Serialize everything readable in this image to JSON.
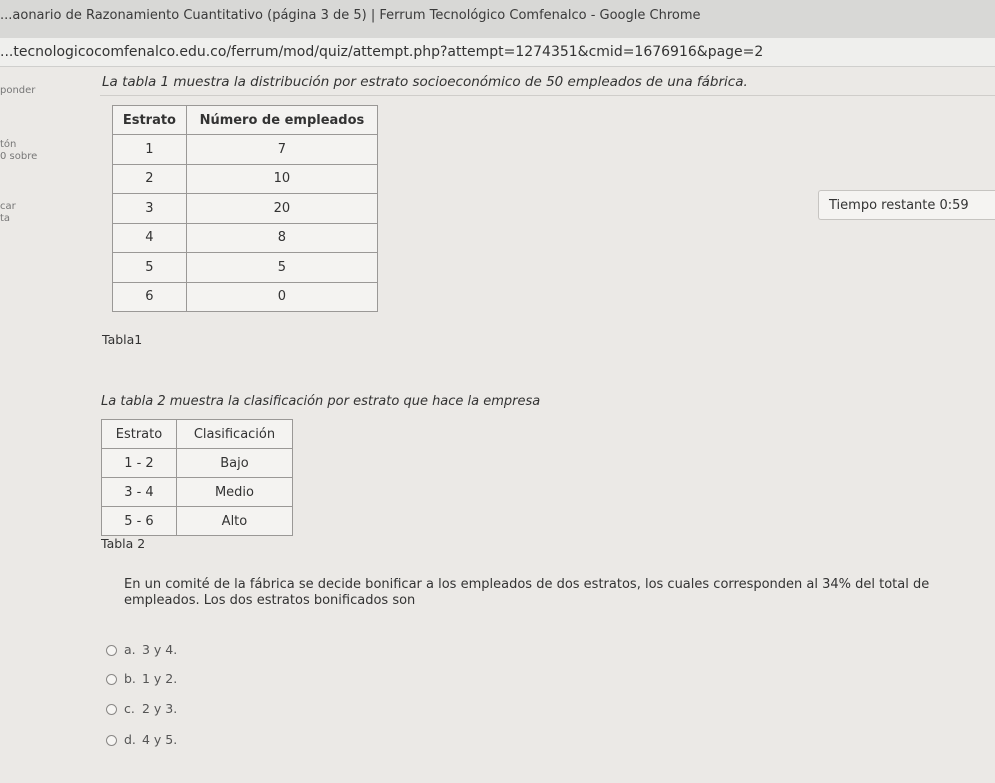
{
  "window": {
    "title": "...aonario de Razonamiento Cuantitativo (página 3 de 5) | Ferrum Tecnológico Comfenalco - Google Chrome"
  },
  "browser": {
    "url": "...tecnologicocomfenalco.edu.co/ferrum/mod/quiz/attempt.php?attempt=1274351&cmid=1676916&page=2"
  },
  "sidebar": {
    "items": [
      "ponder",
      "tón",
      "0 sobre",
      "car",
      "ta"
    ]
  },
  "question": {
    "intro": "La tabla 1 muestra la distribución por estrato socioeconómico de 50 empleados de una fábrica.",
    "table1": {
      "caption": "Tabla1",
      "headers": [
        "Estrato",
        "Número de empleados"
      ],
      "rows": [
        [
          "1",
          "7"
        ],
        [
          "2",
          "10"
        ],
        [
          "3",
          "20"
        ],
        [
          "4",
          "8"
        ],
        [
          "5",
          "5"
        ],
        [
          "6",
          "0"
        ]
      ]
    },
    "table2_intro": "La tabla 2 muestra la clasificación por estrato que hace la empresa",
    "table2": {
      "caption": "Tabla 2",
      "headers": [
        "Estrato",
        "Clasificación"
      ],
      "rows": [
        [
          "1 - 2",
          "Bajo"
        ],
        [
          "3 - 4",
          "Medio"
        ],
        [
          "5 - 6",
          "Alto"
        ]
      ]
    },
    "prompt": "En un comité de la fábrica se decide bonificar a los empleados de dos estratos, los cuales corresponden al 34% del total de empleados. Los dos estratos bonificados son",
    "options": [
      {
        "letter": "a.",
        "text": "3 y 4."
      },
      {
        "letter": "b.",
        "text": "1 y 2."
      },
      {
        "letter": "c.",
        "text": "2 y 3."
      },
      {
        "letter": "d.",
        "text": "4 y 5."
      }
    ]
  },
  "timer": {
    "label": "Tiempo restante 0:59"
  }
}
